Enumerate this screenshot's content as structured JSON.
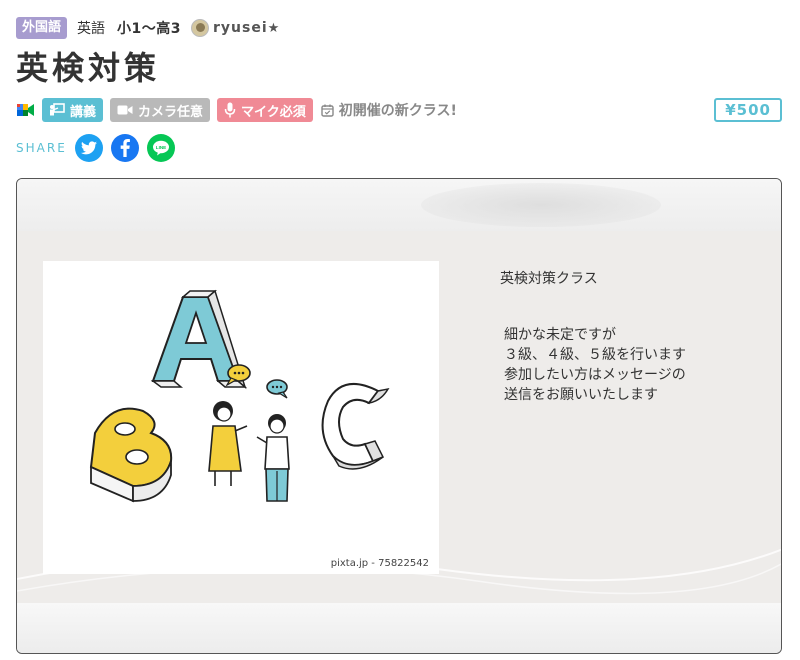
{
  "header": {
    "category": "外国語",
    "subject": "英語",
    "grade": "小1〜高3",
    "teacher_name": "ryusei",
    "teacher_star": "★"
  },
  "title": "英検対策",
  "tags": {
    "meet_icon": "google-meet-icon",
    "lecture": "講義",
    "camera": "カメラ任意",
    "mic": "マイク必須",
    "first_class": "初開催の新クラス!"
  },
  "price": "¥500",
  "share": {
    "label": "SHARE",
    "icons": [
      "twitter-icon",
      "facebook-icon",
      "line-icon"
    ]
  },
  "card": {
    "image_credit": "pixta.jp - 75822542",
    "description_title": "英検対策クラス",
    "description_lines": [
      "細かな未定ですが",
      "３級、４級、５級を行います",
      "参加したい方はメッセージの",
      "送信をお願いいたします"
    ]
  },
  "colors": {
    "category_badge": "#a79ccf",
    "accent": "#5bbfd3",
    "camera_tag": "#b9b9b9",
    "mic_tag": "#f08a95",
    "twitter": "#1da1f2",
    "facebook": "#1877f2",
    "line": "#06c755"
  }
}
